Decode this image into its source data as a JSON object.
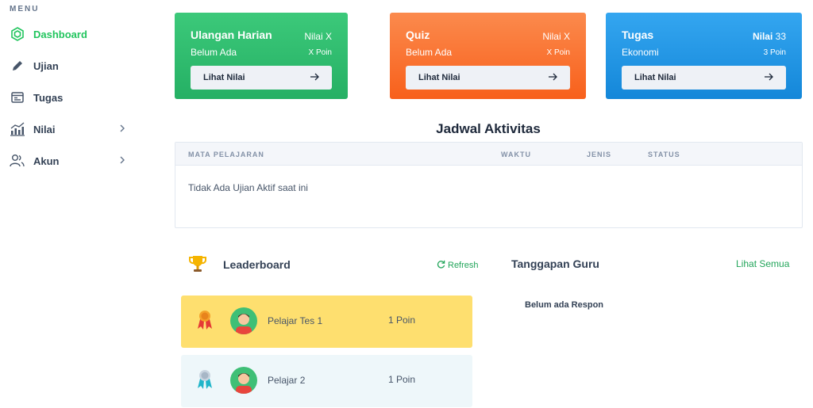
{
  "sidebar": {
    "menu_title": "MENU",
    "items": [
      {
        "label": "Dashboard",
        "icon": "dashboard-icon"
      },
      {
        "label": "Ujian",
        "icon": "pencil-icon"
      },
      {
        "label": "Tugas",
        "icon": "clipboard-icon"
      },
      {
        "label": "Nilai",
        "icon": "chart-icon"
      },
      {
        "label": "Akun",
        "icon": "users-icon"
      }
    ]
  },
  "cards": [
    {
      "title": "Ulangan Harian",
      "subtitle": "Belum Ada",
      "value": "Nilai X",
      "points": "X Poin",
      "button": "Lihat Nilai"
    },
    {
      "title": "Quiz",
      "subtitle": "Belum Ada",
      "value": "Nilai X",
      "points": "X Poin",
      "button": "Lihat Nilai"
    },
    {
      "title": "Tugas",
      "subtitle": "Ekonomi",
      "value_label": "Nilai",
      "value_number": "33",
      "points": "3 Poin",
      "button": "Lihat Nilai"
    }
  ],
  "schedule": {
    "title": "Jadwal Aktivitas",
    "columns": [
      "MATA PELAJARAN",
      "WAKTU",
      "JENIS",
      "STATUS"
    ],
    "empty_message": "Tidak Ada Ujian Aktif saat ini"
  },
  "leaderboard": {
    "title": "Leaderboard",
    "refresh": "Refresh",
    "rows": [
      {
        "name": "Pelajar Tes 1",
        "points": "1 Poin"
      },
      {
        "name": "Pelajar 2",
        "points": "1 Poin"
      }
    ]
  },
  "teacher_response": {
    "title": "Tanggapan Guru",
    "see_all": "Lihat Semua",
    "empty": "Belum ada Respon"
  },
  "colors": {
    "accent_green": "#22c55e",
    "card_green": "#2ebd6f",
    "card_orange": "#f97531",
    "card_blue": "#1f97e5",
    "gold_row": "#fedf6f"
  }
}
